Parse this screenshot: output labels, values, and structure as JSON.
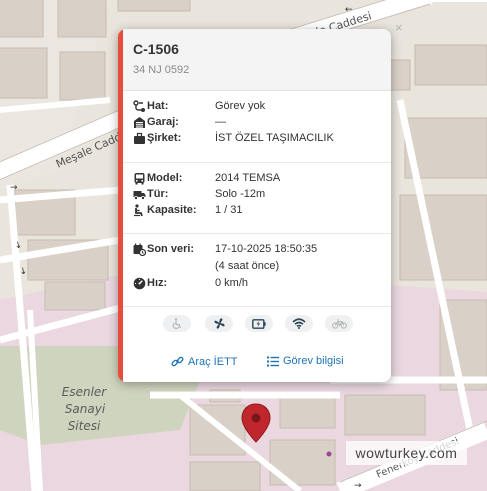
{
  "map": {
    "streets": {
      "mesale_top": "Meşale Caddesi",
      "mesale_left": "Meşale Cadd",
      "fenerkoy": "Fenerköy Caddesi"
    },
    "area_label": [
      "Esenler",
      "Sanayi",
      "Sitesi"
    ],
    "watermark": "wowturkey.com"
  },
  "popup": {
    "title": "C-1506",
    "plate": "34 NJ 0592",
    "close_symbol": "×",
    "rows1": [
      {
        "icon": "route-icon",
        "label": "Hat:",
        "value": "Görev yok"
      },
      {
        "icon": "garage-icon",
        "label": "Garaj:",
        "value": "—"
      },
      {
        "icon": "briefcase-icon",
        "label": "Şirket:",
        "value": "İST ÖZEL TAŞIMACILIK"
      }
    ],
    "rows2": [
      {
        "icon": "bus-icon",
        "label": "Model:",
        "value": "2014 TEMSA"
      },
      {
        "icon": "truck-icon",
        "label": "Tür:",
        "value": "Solo -12m"
      },
      {
        "icon": "passenger-icon",
        "label": "Kapasite:",
        "value": "1 / 31"
      }
    ],
    "rows3": [
      {
        "icon": "calendar-clock-icon",
        "label": "Son veri:",
        "value": "17-10-2025 18:50:35",
        "value2": "(4 saat önce)"
      },
      {
        "icon": "speedometer-icon",
        "label": "Hız:",
        "value": "0 km/h"
      }
    ],
    "features": [
      "wheelchair-icon",
      "air-conditioning-icon",
      "usb-charger-icon",
      "wifi-icon",
      "bicycle-icon"
    ],
    "links": {
      "vehicle": "Araç İETT",
      "duty": "Görev bilgisi"
    },
    "accent_color": "#e74c3c",
    "link_color": "#1e73b8"
  },
  "marker_color": "#c0272d"
}
